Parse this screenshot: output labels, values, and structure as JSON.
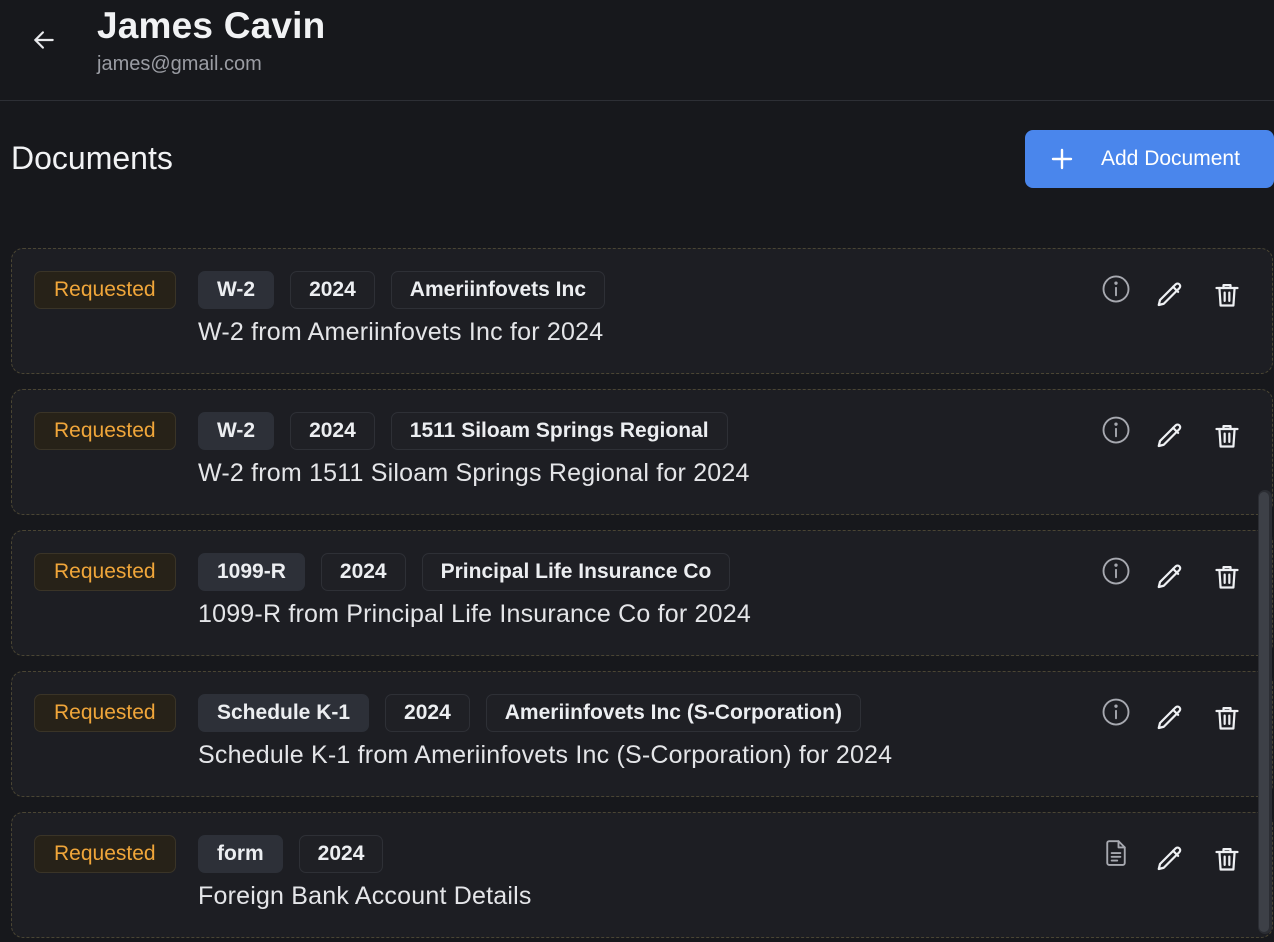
{
  "header": {
    "name": "James Cavin",
    "email": "james@gmail.com",
    "back_icon": "arrow-left-icon"
  },
  "section": {
    "title": "Documents",
    "add_button_label": "Add Document",
    "add_icon": "plus-icon"
  },
  "colors": {
    "background": "#17181c",
    "card": "#1d1e23",
    "accent": "#4a86ec",
    "status_requested": "#f0a63a"
  },
  "documents": [
    {
      "status": "Requested",
      "type": "W-2",
      "year": "2024",
      "issuer": "Ameriinfovets Inc",
      "description": "W-2 from Ameriinfovets Inc for 2024",
      "lead_icon": "info-icon"
    },
    {
      "status": "Requested",
      "type": "W-2",
      "year": "2024",
      "issuer": "1511 Siloam Springs Regional",
      "description": "W-2 from 1511 Siloam Springs Regional for 2024",
      "lead_icon": "info-icon"
    },
    {
      "status": "Requested",
      "type": "1099-R",
      "year": "2024",
      "issuer": "Principal Life Insurance Co",
      "description": "1099-R from Principal Life Insurance Co for 2024",
      "lead_icon": "info-icon"
    },
    {
      "status": "Requested",
      "type": "Schedule K-1",
      "year": "2024",
      "issuer": "Ameriinfovets Inc (S-Corporation)",
      "description": "Schedule K-1 from Ameriinfovets Inc (S-Corporation) for 2024",
      "lead_icon": "info-icon"
    },
    {
      "status": "Requested",
      "type": "form",
      "year": "2024",
      "issuer": "",
      "description": "Foreign Bank Account Details",
      "lead_icon": "document-icon"
    }
  ]
}
